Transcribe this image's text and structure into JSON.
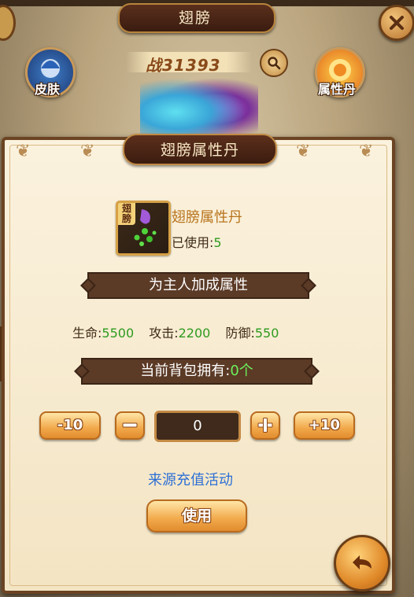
{
  "background": {
    "title": "翅膀",
    "skin_label": "皮肤",
    "pill_label": "属性丹",
    "power_text": "战31393"
  },
  "dialog": {
    "title": "翅膀属性丹",
    "item_name": "翅膀属性丹",
    "item_badge": "翅膀",
    "used_label": "已使用:",
    "used_value": "5",
    "banner_bonus": "为主人加成属性",
    "stats": [
      {
        "label": "生命:",
        "value": "5500"
      },
      {
        "label": "攻击:",
        "value": "2200"
      },
      {
        "label": "防御:",
        "value": "550"
      }
    ],
    "backpack_label": "当前背包拥有:",
    "backpack_value": "0个",
    "minus10_label": "-10",
    "plus10_label": "+10",
    "quantity_value": "0",
    "source_link": "来源充值活动",
    "use_button": "使用"
  },
  "colors": {
    "accent_orange": "#f2a94b",
    "dark_brown": "#5b3a26",
    "value_green": "#2e9a1f",
    "link_blue": "#2d6fd6"
  },
  "icons": [
    "close-icon",
    "search-icon",
    "skin-icon",
    "pill-icon",
    "back-arrow-icon",
    "minus-icon",
    "plus-icon"
  ]
}
